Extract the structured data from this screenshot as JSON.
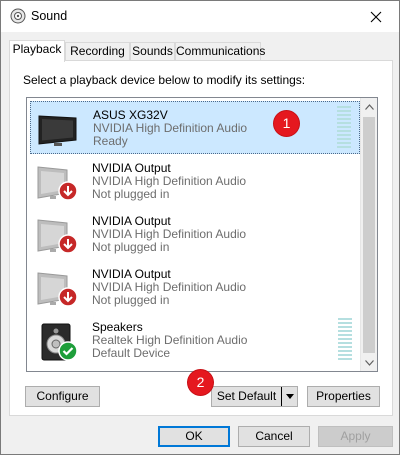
{
  "window": {
    "title": "Sound",
    "icon": "speaker-icon",
    "close_icon": "close-icon"
  },
  "tabs": [
    {
      "label": "Playback",
      "active": true
    },
    {
      "label": "Recording",
      "active": false
    },
    {
      "label": "Sounds",
      "active": false
    },
    {
      "label": "Communications",
      "active": false
    }
  ],
  "instruction": "Select a playback device below to modify its settings:",
  "devices": [
    {
      "name": "ASUS XG32V",
      "driver": "NVIDIA High Definition Audio",
      "status": "Ready",
      "icon": "monitor-icon",
      "overlay": "",
      "selected": true
    },
    {
      "name": "NVIDIA Output",
      "driver": "NVIDIA High Definition Audio",
      "status": "Not plugged in",
      "icon": "monitor-icon",
      "overlay": "red-down-arrow-icon",
      "selected": false
    },
    {
      "name": "NVIDIA Output",
      "driver": "NVIDIA High Definition Audio",
      "status": "Not plugged in",
      "icon": "monitor-icon",
      "overlay": "red-down-arrow-icon",
      "selected": false
    },
    {
      "name": "NVIDIA Output",
      "driver": "NVIDIA High Definition Audio",
      "status": "Not plugged in",
      "icon": "monitor-icon",
      "overlay": "red-down-arrow-icon",
      "selected": false
    },
    {
      "name": "Speakers",
      "driver": "Realtek High Definition Audio",
      "status": "Default Device",
      "icon": "speakers-icon",
      "overlay": "green-check-icon",
      "selected": false
    }
  ],
  "buttons": {
    "configure": "Configure",
    "set_default": "Set Default",
    "properties": "Properties",
    "ok": "OK",
    "cancel": "Cancel",
    "apply": "Apply"
  },
  "annotations": [
    "1",
    "2"
  ],
  "colors": {
    "selection": "#cce8ff",
    "badge": "#e5181f",
    "meter": "#b5dfe0",
    "focus_border": "#0078d7"
  }
}
